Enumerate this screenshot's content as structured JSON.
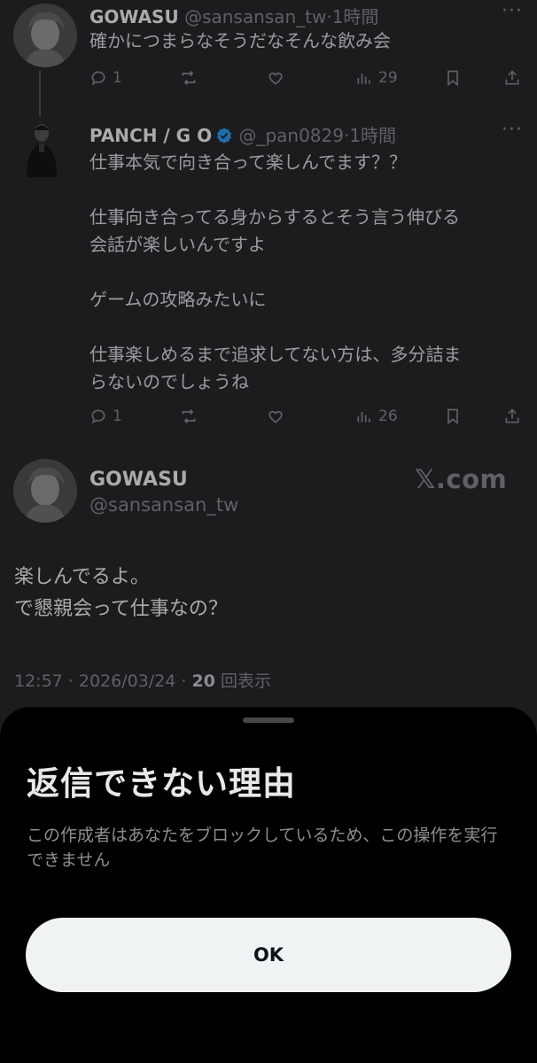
{
  "tweet1": {
    "name": "GOWASU",
    "handle": "@sansansan_tw",
    "time": "1時間",
    "text": "確かにつまらなそうだなそんな飲み会",
    "replies": "1",
    "views": "29"
  },
  "tweet2": {
    "name": "PANCH / G O",
    "handle": "@_pan0829",
    "time": "1時間",
    "text": "仕事本気で向き合って楽しんでます？？\n\n仕事向き合ってる身からするとそう言う伸びる\n会話が楽しいんですよ\n\nゲームの攻略みたいに\n\n仕事楽しめるまで追求してない方は、多分詰ま\nらないのでしょうね",
    "replies": "1",
    "views": "26"
  },
  "main_tweet": {
    "name": "GOWASU",
    "handle": "@sansansan_tw",
    "watermark": "𝕏.com",
    "text": "楽しんでるよ。\nで懇親会って仕事なの？",
    "timestamp": "12:57 · 2026/03/24 · ",
    "view_count": "20",
    "view_label": " 回表示"
  },
  "sheet": {
    "title": "返信できない理由",
    "body": "この作成者はあなたをブロックしているため、この操作を実行できません",
    "ok_label": "OK"
  },
  "colors": {
    "background": "#1c1c1e",
    "sheet": "#000000",
    "button": "#eff3f4",
    "verified": "#1d9bf0"
  },
  "icons": [
    "reply-icon",
    "retweet-icon",
    "like-icon",
    "views-icon",
    "bookmark-icon",
    "share-icon",
    "more-icon",
    "verified-badge-icon"
  ]
}
